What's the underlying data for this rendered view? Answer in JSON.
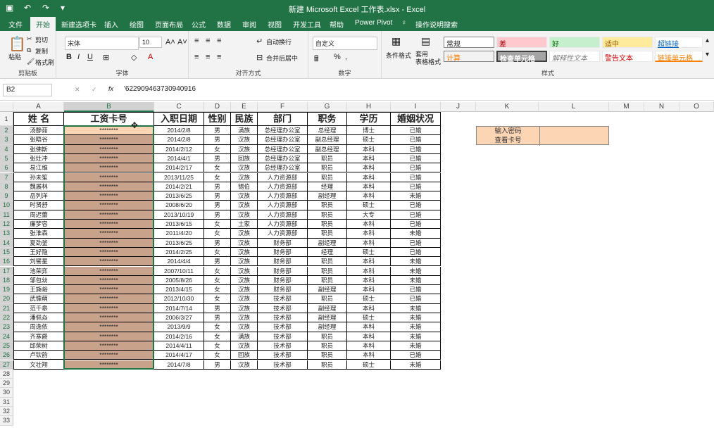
{
  "title": "新建 Microsoft Excel 工作表.xlsx  -  Excel",
  "tabs": [
    "文件",
    "开始",
    "新建选项卡",
    "插入",
    "绘图",
    "页面布局",
    "公式",
    "数据",
    "审阅",
    "视图",
    "开发工具",
    "帮助",
    "Power Pivot",
    "操作说明搜索"
  ],
  "ribbon": {
    "clipboard": {
      "paste": "粘贴",
      "cut": "剪切",
      "copy": "复制",
      "painter": "格式刷",
      "label": "剪贴板"
    },
    "font": {
      "name": "宋体",
      "size": "10",
      "label": "字体"
    },
    "align": {
      "wrap": "自动换行",
      "merge": "合并后居中",
      "label": "对齐方式"
    },
    "number": {
      "format": "自定义",
      "label": "数字"
    },
    "styles": {
      "cond": "条件格式",
      "table": "套用\n表格格式",
      "label": "样式",
      "cells": [
        "常规",
        "差",
        "好",
        "适中",
        "超链接",
        "计算",
        "检查单元格",
        "解释性文本",
        "警告文本",
        "链接单元格"
      ]
    }
  },
  "formula": {
    "namebox": "B2",
    "value": "'622909463730940916"
  },
  "columns": [
    "A",
    "B",
    "C",
    "D",
    "E",
    "F",
    "G",
    "H",
    "I",
    "J",
    "K",
    "L",
    "M",
    "N",
    "O"
  ],
  "headers": [
    "姓 名",
    "工资卡号",
    "入职日期",
    "性别",
    "民族",
    "部门",
    "职务",
    "学历",
    "婚姻状况"
  ],
  "rows": [
    [
      "汤静茹",
      "********",
      "2014/2/8",
      "男",
      "满族",
      "总经理办公室",
      "总经理",
      "博士",
      "已婚"
    ],
    [
      "张晤谷",
      "********",
      "2014/2/8",
      "男",
      "汉族",
      "总经理办公室",
      "副总经理",
      "硕士",
      "已婚"
    ],
    [
      "张佛斯",
      "********",
      "2014/2/12",
      "女",
      "汉族",
      "总经理办公室",
      "副总经理",
      "本科",
      "已婚"
    ],
    [
      "张灶冲",
      "********",
      "2014/4/1",
      "男",
      "回族",
      "总经理办公室",
      "职员",
      "本科",
      "已婚"
    ],
    [
      "易江维",
      "********",
      "2014/2/17",
      "女",
      "汉族",
      "总经理办公室",
      "职员",
      "本科",
      "已婚"
    ],
    [
      "孙未笙",
      "********",
      "2013/11/25",
      "女",
      "汉族",
      "人力资源部",
      "职员",
      "本科",
      "已婚"
    ],
    [
      "魏展林",
      "********",
      "2014/2/21",
      "男",
      "锡伯",
      "人力资源部",
      "经理",
      "本科",
      "已婚"
    ],
    [
      "岳列洋",
      "********",
      "2013/6/25",
      "男",
      "汉族",
      "人力资源部",
      "副经理",
      "本科",
      "未婚"
    ],
    [
      "时贤舒",
      "********",
      "2008/6/20",
      "男",
      "汉族",
      "人力资源部",
      "职员",
      "硕士",
      "已婚"
    ],
    [
      "周迟蕾",
      "********",
      "2013/10/19",
      "男",
      "汉族",
      "人力资源部",
      "职员",
      "大专",
      "已婚"
    ],
    [
      "廉梦容",
      "********",
      "2013/6/15",
      "女",
      "土家",
      "人力资源部",
      "职员",
      "本科",
      "已婚"
    ],
    [
      "张淮森",
      "********",
      "2011/4/20",
      "女",
      "汉族",
      "人力资源部",
      "职员",
      "本科",
      "未婚"
    ],
    [
      "夏劲釜",
      "********",
      "2013/6/25",
      "男",
      "汉族",
      "财务部",
      "副经理",
      "本科",
      "已婚"
    ],
    [
      "王好隐",
      "********",
      "2014/2/25",
      "女",
      "汉族",
      "财务部",
      "经理",
      "硕士",
      "已婚"
    ],
    [
      "刘譬星",
      "********",
      "2014/4/4",
      "男",
      "汉族",
      "财务部",
      "职员",
      "本科",
      "未婚"
    ],
    [
      "池荣弈",
      "********",
      "2007/10/11",
      "女",
      "汉族",
      "财务部",
      "职员",
      "本科",
      "未婚"
    ],
    [
      "邹包幼",
      "********",
      "2005/8/26",
      "女",
      "汉族",
      "财务部",
      "职员",
      "本科",
      "未婚"
    ],
    [
      "王旖峪",
      "********",
      "2013/4/15",
      "女",
      "汉族",
      "财务部",
      "副经理",
      "本科",
      "已婚"
    ],
    [
      "武慷萌",
      "********",
      "2012/10/30",
      "女",
      "汉族",
      "技术部",
      "职员",
      "硕士",
      "已婚"
    ],
    [
      "范千皋",
      "********",
      "2014/7/14",
      "男",
      "汉族",
      "技术部",
      "副经理",
      "本科",
      "未婚"
    ],
    [
      "潘佩焱",
      "********",
      "2006/3/27",
      "男",
      "汉族",
      "技术部",
      "副经理",
      "硕士",
      "未婚"
    ],
    [
      "周逸依",
      "********",
      "2013/9/9",
      "女",
      "汉族",
      "技术部",
      "副经理",
      "本科",
      "未婚"
    ],
    [
      "齐寒爵",
      "********",
      "2014/2/16",
      "女",
      "满族",
      "技术部",
      "职员",
      "本科",
      "未婚"
    ],
    [
      "邱荣树",
      "********",
      "2014/4/11",
      "女",
      "汉族",
      "技术部",
      "职员",
      "本科",
      "未婚"
    ],
    [
      "卢钦韵",
      "********",
      "2014/4/17",
      "女",
      "回族",
      "技术部",
      "职员",
      "本科",
      "已婚"
    ],
    [
      "文壮翔",
      "********",
      "2014/7/8",
      "男",
      "汉族",
      "技术部",
      "职员",
      "硕士",
      "未婚"
    ]
  ],
  "password_box": {
    "l1": "输入密码",
    "l2": "查看卡号"
  }
}
